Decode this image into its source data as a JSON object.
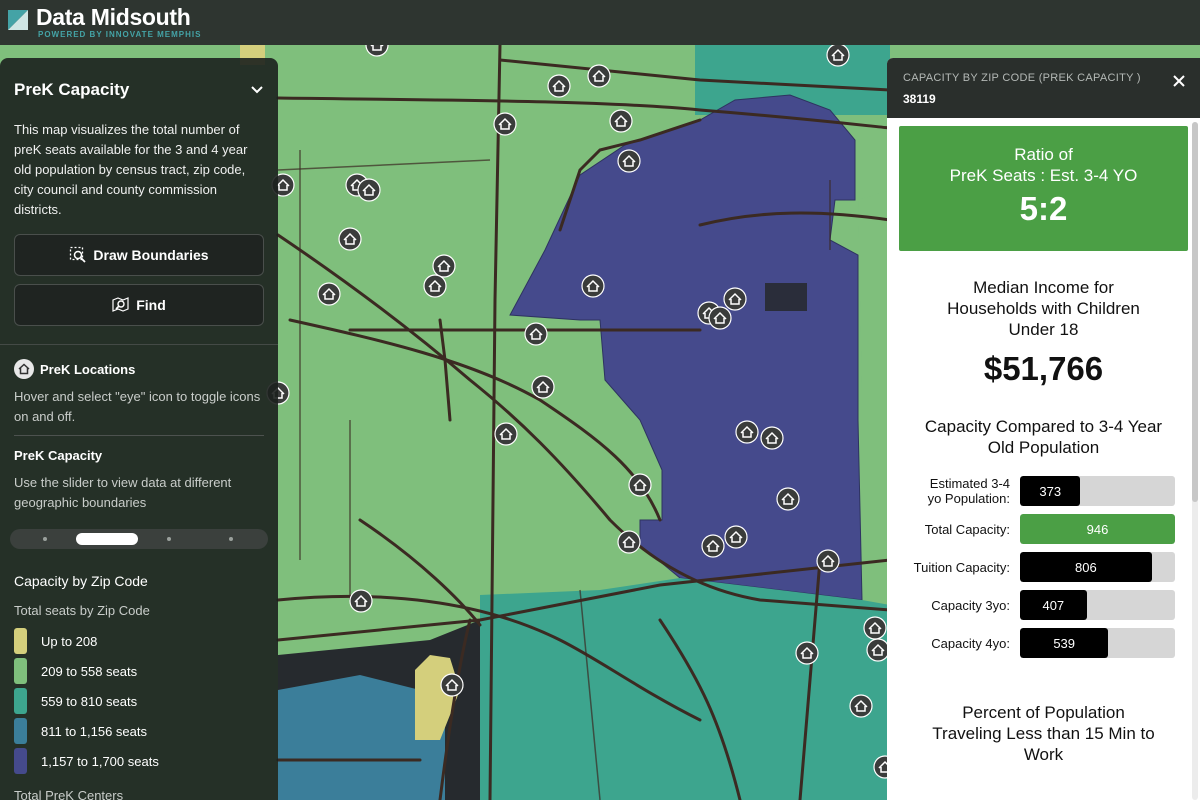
{
  "app": {
    "title": "Data Midsouth",
    "subtitle": "POWERED BY INNOVATE MEMPHIS"
  },
  "left_panel": {
    "title": "PreK Capacity",
    "description": "This map visualizes the total number of preK seats available for the 3 and 4 year old population by census tract, zip code, city council and county commission districts.",
    "draw_boundaries_label": "Draw Boundaries",
    "find_label": "Find",
    "locations": {
      "title": "PreK Locations",
      "hint": "Hover and select \"eye\" icon to toggle icons on and off."
    },
    "capacity": {
      "title": "PreK Capacity",
      "hint": "Use the slider to view data at different geographic boundaries"
    },
    "legend": {
      "title": "Capacity by Zip Code",
      "subtitle": "Total seats by Zip Code",
      "items": [
        {
          "label": "Up to 208",
          "color": "#d4cf7c"
        },
        {
          "label": "209 to 558 seats",
          "color": "#7fbf7c"
        },
        {
          "label": "559 to 810 seats",
          "color": "#3da58e"
        },
        {
          "label": "811 to 1,156 seats",
          "color": "#3b7e9a"
        },
        {
          "label": "1,157 to 1,700 seats",
          "color": "#454a8c"
        }
      ]
    },
    "footer": "Total PreK Centers"
  },
  "right_panel": {
    "header_label": "CAPACITY BY ZIP CODE (PREK CAPACITY )",
    "zip": "38119",
    "ratio": {
      "title_line1": "Ratio of",
      "title_line2": "PreK Seats : Est. 3-4 YO",
      "value": "5:2"
    },
    "income": {
      "title_line1": "Median Income for",
      "title_line2": "Households with Children",
      "title_line3": "Under 18",
      "value": "$51,766"
    },
    "capacity": {
      "title_line1": "Capacity Compared to 3-4 Year",
      "title_line2": "Old Population",
      "bars": [
        {
          "label_line1": "Estimated 3-4",
          "label_line2": "yo Population:",
          "value": "373",
          "fraction": 0.39,
          "color": "#000000"
        },
        {
          "label_line1": "Total Capacity:",
          "label_line2": "",
          "value": "946",
          "fraction": 1.0,
          "color": "#4b9f45"
        },
        {
          "label_line1": "Tuition Capacity:",
          "label_line2": "",
          "value": "806",
          "fraction": 0.85,
          "color": "#000000"
        },
        {
          "label_line1": "Capacity 3yo:",
          "label_line2": "",
          "value": "407",
          "fraction": 0.43,
          "color": "#000000"
        },
        {
          "label_line1": "Capacity 4yo:",
          "label_line2": "",
          "value": "539",
          "fraction": 0.57,
          "color": "#000000"
        }
      ]
    },
    "percent": {
      "title_line1": "Percent of Population",
      "title_line2": "Traveling Less than 15 Min to",
      "title_line3": "Work"
    }
  },
  "colors": {
    "accent_green": "#4b9f45",
    "brand_teal": "#44a3a6",
    "zip_selected": "#454a8c"
  }
}
